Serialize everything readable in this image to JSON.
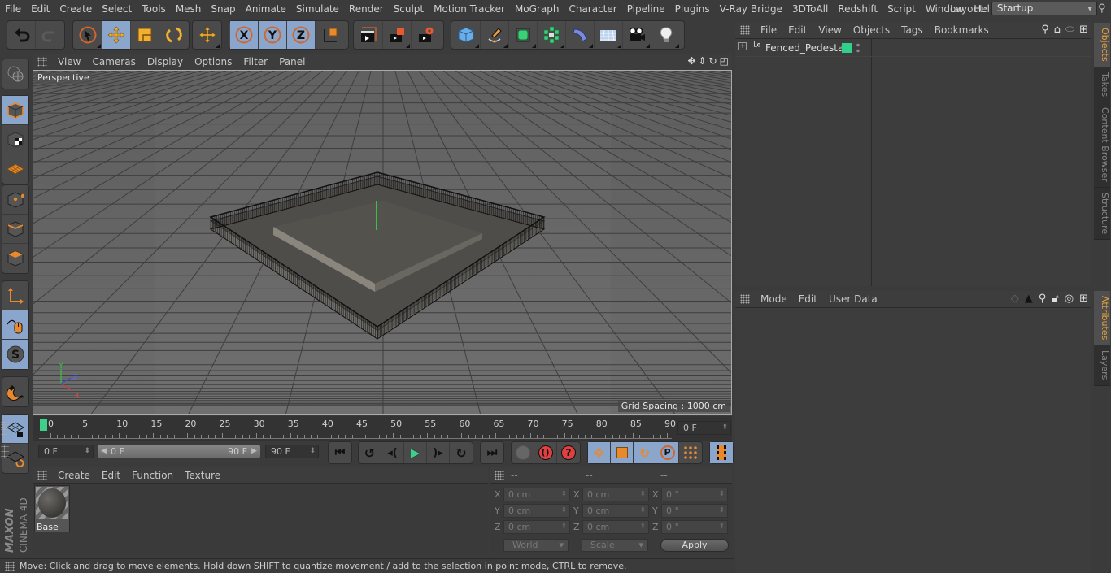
{
  "menubar": {
    "items": [
      "File",
      "Edit",
      "Create",
      "Select",
      "Tools",
      "Mesh",
      "Snap",
      "Animate",
      "Simulate",
      "Render",
      "Sculpt",
      "Motion Tracker",
      "MoGraph",
      "Character",
      "Pipeline",
      "Plugins",
      "V-Ray Bridge",
      "3DToAll",
      "Redshift",
      "Script",
      "Window",
      "Help"
    ],
    "layout_label": "Layout:",
    "layout_value": "Startup"
  },
  "toolbar": {
    "groups": [
      [
        "undo-icon",
        "redo-icon"
      ],
      [
        "live-selection-icon",
        "move-icon",
        "scale-icon",
        "rotate-icon"
      ],
      [
        "recent-tool-icon"
      ],
      [
        "x-axis-lock-icon",
        "y-axis-lock-icon",
        "z-axis-lock-icon",
        "coordinate-system-icon"
      ],
      [
        "render-view-icon",
        "render-to-picture-viewer-icon",
        "render-settings-icon"
      ],
      [
        "cube-primitive-icon",
        "pen-spline-icon",
        "subdivision-surface-icon",
        "cloner-icon",
        "bend-deformer-icon",
        "floor-icon",
        "camera-icon",
        "light-icon"
      ]
    ]
  },
  "left_toolbar": {
    "items": [
      "make-editable-icon",
      "model-mode-icon",
      "texture-mode-icon",
      "workplane-mode-icon",
      "points-mode-icon",
      "edges-mode-icon",
      "polygons-mode-icon",
      "axis-mode-icon",
      "tweak-mode-icon",
      "solo-mode-icon",
      "snap-icon",
      "workplane-lock-icon",
      "workplane-align-icon"
    ]
  },
  "viewport": {
    "menu": [
      "View",
      "Cameras",
      "Display",
      "Options",
      "Filter",
      "Panel"
    ],
    "camera_label": "Perspective",
    "grid_spacing": "Grid Spacing : 1000 cm",
    "axis_labels": {
      "x": "X",
      "y": "Y",
      "z": "Z"
    }
  },
  "timeline": {
    "ticks": [
      "0",
      "5",
      "10",
      "15",
      "20",
      "25",
      "30",
      "35",
      "40",
      "45",
      "50",
      "55",
      "60",
      "65",
      "70",
      "75",
      "80",
      "85",
      "90"
    ],
    "current_frame": "0 F",
    "start_field": "0 F",
    "range_start": "0 F",
    "range_end": "90 F",
    "end_field": "90 F"
  },
  "materials": {
    "menu": [
      "Create",
      "Edit",
      "Function",
      "Texture"
    ],
    "items": [
      {
        "name": "Base"
      }
    ]
  },
  "coordinates": {
    "headers": [
      "--",
      "--",
      "--"
    ],
    "rows": [
      {
        "axis": "X",
        "pos": "0 cm",
        "size": "0 cm",
        "rot": "0 °"
      },
      {
        "axis": "Y",
        "pos": "0 cm",
        "size": "0 cm",
        "rot": "0 °"
      },
      {
        "axis": "Z",
        "pos": "0 cm",
        "size": "0 cm",
        "rot": "0 °"
      }
    ],
    "mode_select": "World",
    "type_select": "Scale",
    "apply_label": "Apply"
  },
  "objects_panel": {
    "menu": [
      "File",
      "Edit",
      "View",
      "Objects",
      "Tags",
      "Bookmarks"
    ],
    "objects": [
      {
        "name": "Fenced_Pedestal",
        "color": "#2ed08a"
      }
    ]
  },
  "attributes_panel": {
    "menu": [
      "Mode",
      "Edit",
      "User Data"
    ]
  },
  "right_tabs_top": [
    {
      "label": "Objects",
      "active": true
    },
    {
      "label": "Takes",
      "active": false
    },
    {
      "label": "Content Browser",
      "active": false
    },
    {
      "label": "Structure",
      "active": false
    }
  ],
  "right_tabs_bottom": [
    {
      "label": "Attributes",
      "active": true
    },
    {
      "label": "Layers",
      "active": false
    }
  ],
  "statusbar": {
    "text": "Move: Click and drag to move elements. Hold down SHIFT to quantize movement / add to the selection in point mode, CTRL to remove."
  },
  "logo": {
    "brand": "MAXON",
    "product": "CINEMA 4D"
  },
  "colors": {
    "accent": "#e8a23a",
    "active_button": "#8aa6cc",
    "object_tag": "#2ed08a"
  }
}
